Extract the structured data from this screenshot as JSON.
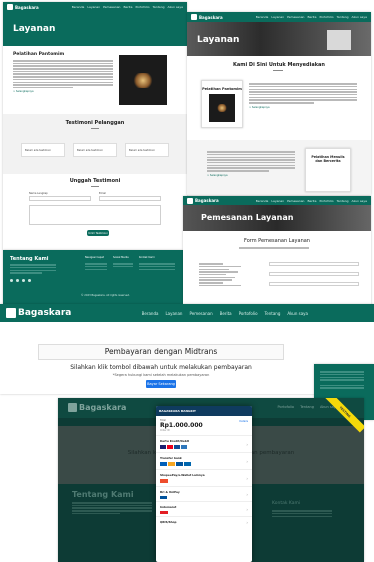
{
  "brand": "Bagaskara",
  "nav": [
    "Beranda",
    "Layanan",
    "Pemesanan",
    "Berita",
    "Portofolio",
    "Tentang",
    "Akun saya"
  ],
  "page_layanan_left": {
    "hero_title": "Layanan",
    "section_title": "Pelatihan Pantomim",
    "read_more": "> Selengkapnya",
    "testimoni_title": "Testimoni Pelanggan",
    "testimoni_cards": [
      "Belum ada testimoni",
      "Belum ada testimoni",
      "Belum ada testimoni"
    ],
    "unggah_title": "Unggah Testimoni",
    "field_nama": "Nama Lengkap",
    "field_email": "Email",
    "submit_label": "Kirim Testimoni",
    "footer_title": "Tentang Kami",
    "footer_col2": "Navigasi Cepat",
    "footer_col3": "Sosial Media",
    "footer_col4": "Kontak Kami",
    "copyright": "© 2023 Bagaskara. All rights reserved."
  },
  "page_layanan_right": {
    "hero_title": "Layanan",
    "heading": "Kami Di Sini Untuk Menyediakan",
    "item1_title": "Pelatihan Pantomim",
    "item2_title": "Pelatihan Menulis dan Bercerita",
    "read_more": "> Selengkapnya"
  },
  "page_pemesanan": {
    "hero_title": "Pemesanan Layanan",
    "form_title": "Form Pemesanan Layanan"
  },
  "page_midtrans": {
    "title": "Pembayaran dengan Midtrans",
    "subtitle": "Silahkan klik tombol dibawah untuk melakukan pembayaran",
    "note": "*Segera hubungi kami setelah melakukan pembayaran",
    "button": "Bayar Sekarang",
    "contact_title": "Kontak Kami"
  },
  "page_popup": {
    "banner_text": "Silahkan klik tombol dibawah untuk melakukan pembayaran",
    "footer_title": "Tentang Kami",
    "contact_title": "Kontak Kami",
    "popup_header": "BAGASKARA BANGKIT",
    "total_label": "Total",
    "amount": "Rp1.000.000",
    "order_label": "Order ID",
    "details_link": "Details",
    "methods": [
      "Kartu Kredit/Debit",
      "Transfer bank",
      "ShopeePay/e-Wallet Lainnya",
      "Bri & UniPay",
      "Indomaret",
      "QRIS/Shop"
    ],
    "ribbon": "TESTING"
  }
}
